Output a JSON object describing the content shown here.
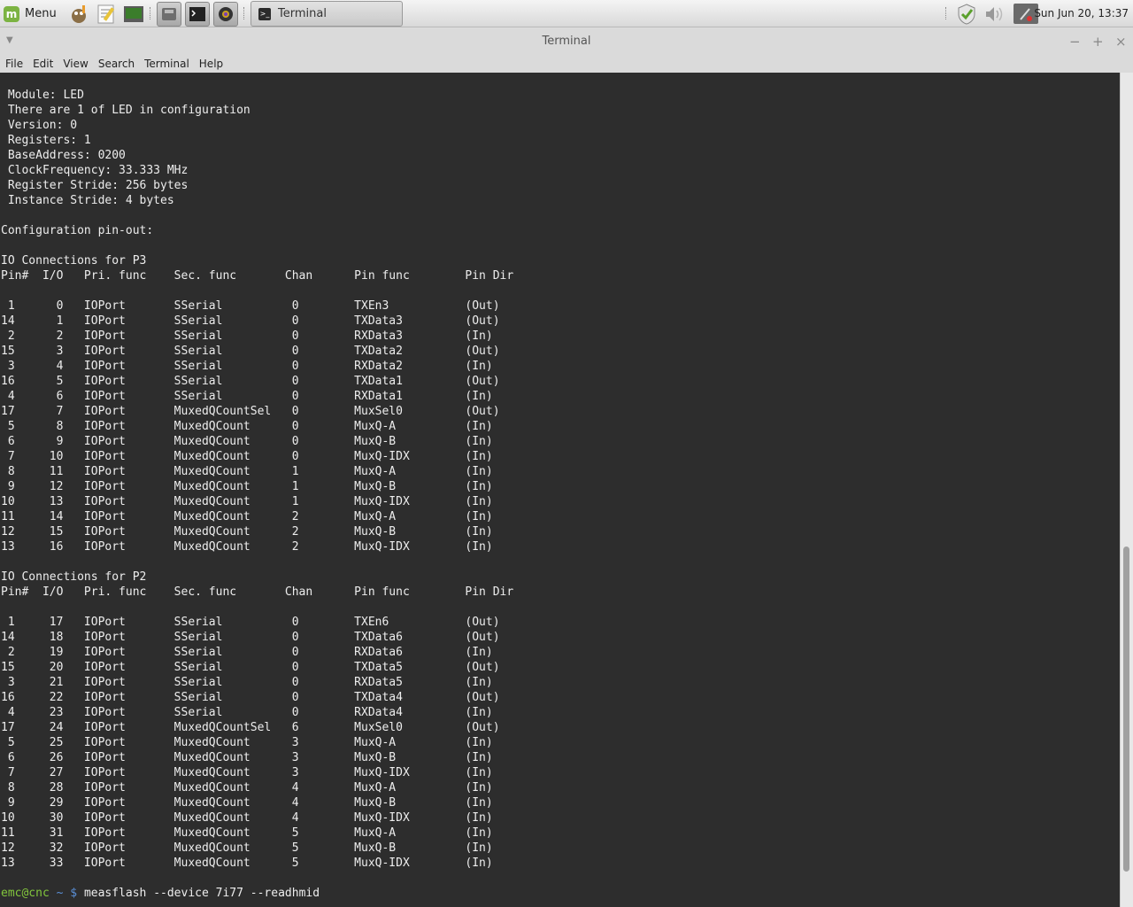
{
  "panel": {
    "menu_label": "Menu",
    "menu_icon_glyph": "m",
    "launchers": [
      {
        "name": "gimp-icon",
        "color": "#8b6f47"
      },
      {
        "name": "text-editor-icon",
        "color": "#e8c43a"
      },
      {
        "name": "system-monitor-icon",
        "color": "#3b7d2b"
      },
      {
        "name": "disk-icon",
        "color": "#6e6e6e"
      },
      {
        "name": "terminal-icon",
        "color": "#222222"
      },
      {
        "name": "camera-icon",
        "color": "#333333"
      }
    ],
    "task": {
      "label": "Terminal",
      "icon_glyph": ">_"
    },
    "tray_icons": [
      "shield-check-icon",
      "volume-icon",
      "network-disconnected-icon"
    ],
    "clock": "Sun Jun 20, 13:37"
  },
  "window": {
    "title": "Terminal",
    "menu_arrow": "▼",
    "controls": {
      "minimize": "−",
      "maximize": "+",
      "close": "×"
    }
  },
  "menubar": [
    "File",
    "Edit",
    "View",
    "Search",
    "Terminal",
    "Help"
  ],
  "terminal": {
    "lines": [
      " Module: LED",
      " There are 1 of LED in configuration",
      " Version: 0",
      " Registers: 1",
      " BaseAddress: 0200",
      " ClockFrequency: 33.333 MHz",
      " Register Stride: 256 bytes",
      " Instance Stride: 4 bytes",
      "",
      "Configuration pin-out:",
      "",
      "IO Connections for P3",
      "Pin#  I/O   Pri. func    Sec. func       Chan      Pin func        Pin Dir",
      "",
      " 1      0   IOPort       SSerial          0        TXEn3           (Out)",
      "14      1   IOPort       SSerial          0        TXData3         (Out)",
      " 2      2   IOPort       SSerial          0        RXData3         (In)",
      "15      3   IOPort       SSerial          0        TXData2         (Out)",
      " 3      4   IOPort       SSerial          0        RXData2         (In)",
      "16      5   IOPort       SSerial          0        TXData1         (Out)",
      " 4      6   IOPort       SSerial          0        RXData1         (In)",
      "17      7   IOPort       MuxedQCountSel   0        MuxSel0         (Out)",
      " 5      8   IOPort       MuxedQCount      0        MuxQ-A          (In)",
      " 6      9   IOPort       MuxedQCount      0        MuxQ-B          (In)",
      " 7     10   IOPort       MuxedQCount      0        MuxQ-IDX        (In)",
      " 8     11   IOPort       MuxedQCount      1        MuxQ-A          (In)",
      " 9     12   IOPort       MuxedQCount      1        MuxQ-B          (In)",
      "10     13   IOPort       MuxedQCount      1        MuxQ-IDX        (In)",
      "11     14   IOPort       MuxedQCount      2        MuxQ-A          (In)",
      "12     15   IOPort       MuxedQCount      2        MuxQ-B          (In)",
      "13     16   IOPort       MuxedQCount      2        MuxQ-IDX        (In)",
      "",
      "IO Connections for P2",
      "Pin#  I/O   Pri. func    Sec. func       Chan      Pin func        Pin Dir",
      "",
      " 1     17   IOPort       SSerial          0        TXEn6           (Out)",
      "14     18   IOPort       SSerial          0        TXData6         (Out)",
      " 2     19   IOPort       SSerial          0        RXData6         (In)",
      "15     20   IOPort       SSerial          0        TXData5         (Out)",
      " 3     21   IOPort       SSerial          0        RXData5         (In)",
      "16     22   IOPort       SSerial          0        TXData4         (Out)",
      " 4     23   IOPort       SSerial          0        RXData4         (In)",
      "17     24   IOPort       MuxedQCountSel   6        MuxSel0         (Out)",
      " 5     25   IOPort       MuxedQCount      3        MuxQ-A          (In)",
      " 6     26   IOPort       MuxedQCount      3        MuxQ-B          (In)",
      " 7     27   IOPort       MuxedQCount      3        MuxQ-IDX        (In)",
      " 8     28   IOPort       MuxedQCount      4        MuxQ-A          (In)",
      " 9     29   IOPort       MuxedQCount      4        MuxQ-B          (In)",
      "10     30   IOPort       MuxedQCount      4        MuxQ-IDX        (In)",
      "11     31   IOPort       MuxedQCount      5        MuxQ-A          (In)",
      "12     32   IOPort       MuxedQCount      5        MuxQ-B          (In)",
      "13     33   IOPort       MuxedQCount      5        MuxQ-IDX        (In)",
      ""
    ],
    "prompt": {
      "user_host": "emc@cnc",
      "path": " ~ $ ",
      "command": "measflash --device 7i77 --readhmid"
    },
    "colors": {
      "background": "#2d2d2d",
      "text": "#ededed",
      "user": "#82c63c",
      "path": "#5a8fd6"
    }
  },
  "scrollbar": {
    "position_fraction": 0.93,
    "visible_fraction": 0.39
  }
}
